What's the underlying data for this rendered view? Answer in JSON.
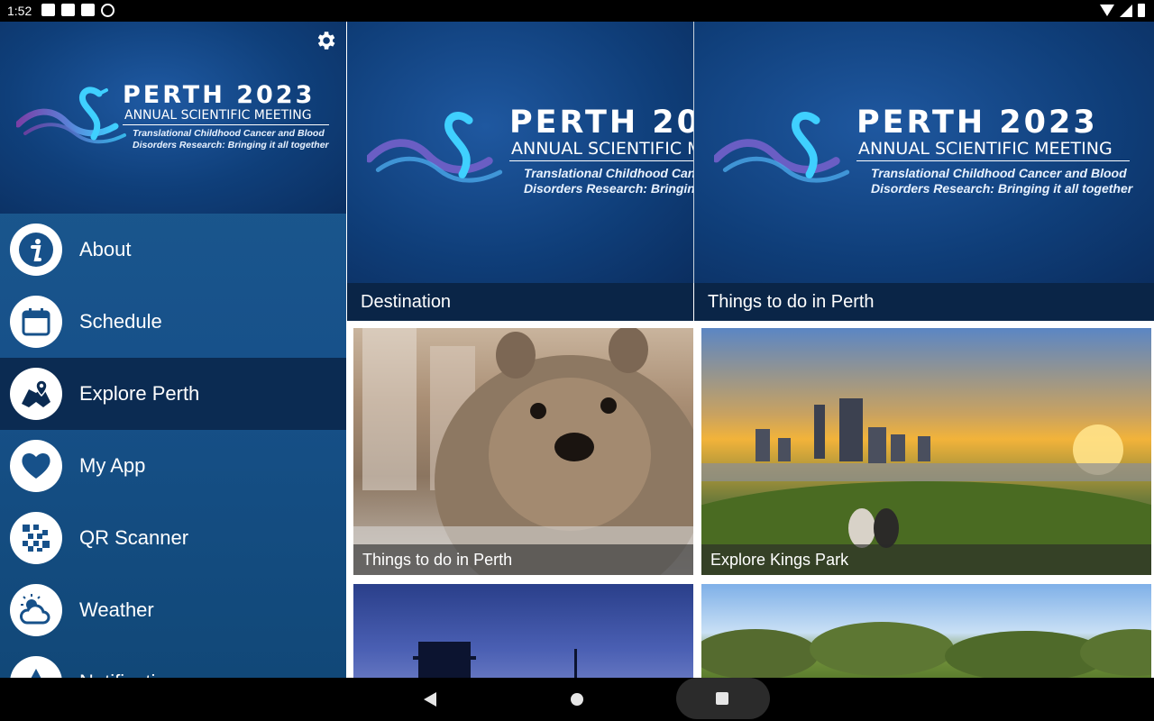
{
  "status_bar": {
    "time": "1:52"
  },
  "logo": {
    "title": "PERTH 2023",
    "subtitle": "ANNUAL SCIENTIFIC MEETING",
    "tagline_line1": "Translational Childhood Cancer and Blood",
    "tagline_line2": "Disorders Research: Bringing it all together"
  },
  "menu": {
    "items": [
      {
        "label": "About",
        "icon": "info-icon"
      },
      {
        "label": "Schedule",
        "icon": "calendar-icon"
      },
      {
        "label": "Explore Perth",
        "icon": "map-pin-icon",
        "active": true
      },
      {
        "label": "My App",
        "icon": "heart-icon"
      },
      {
        "label": "QR Scanner",
        "icon": "qr-code-icon"
      },
      {
        "label": "Weather",
        "icon": "weather-icon"
      },
      {
        "label": "Notifications",
        "icon": "notification-icon"
      }
    ]
  },
  "columns": [
    {
      "header": "Destination",
      "cards": [
        "Things to do in Perth"
      ]
    },
    {
      "header": "Things to do in Perth",
      "cards": [
        "Explore Kings Park"
      ]
    }
  ],
  "colors": {
    "drawer": "#17518a",
    "active_item": "#0b2b52",
    "section_header": "#0a2547"
  }
}
